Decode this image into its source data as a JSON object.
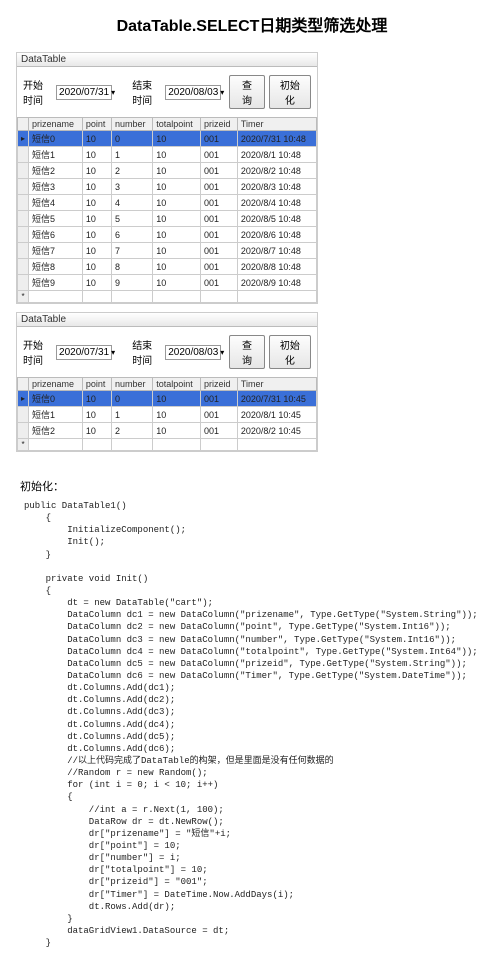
{
  "title": "DataTable.SELECT日期类型筛选处理",
  "win": {
    "caption": "DataTable",
    "startLabel": "开始时间",
    "endLabel": "结束时间",
    "startDate1": "2020/07/31",
    "endDate1": "2020/08/03",
    "startDate2": "2020/07/31",
    "endDate2": "2020/08/03",
    "queryBtn": "查询",
    "initBtn": "初始化"
  },
  "cols": [
    "prizename",
    "point",
    "number",
    "totalpoint",
    "prizeid",
    "Timer"
  ],
  "top": [
    {
      "n": "短信0",
      "p": "10",
      "u": "0",
      "t": "10",
      "id": "001",
      "time": "2020/7/31 10:48"
    },
    {
      "n": "短信1",
      "p": "10",
      "u": "1",
      "t": "10",
      "id": "001",
      "time": "2020/8/1 10:48"
    },
    {
      "n": "短信2",
      "p": "10",
      "u": "2",
      "t": "10",
      "id": "001",
      "time": "2020/8/2 10:48"
    },
    {
      "n": "短信3",
      "p": "10",
      "u": "3",
      "t": "10",
      "id": "001",
      "time": "2020/8/3 10:48"
    },
    {
      "n": "短信4",
      "p": "10",
      "u": "4",
      "t": "10",
      "id": "001",
      "time": "2020/8/4 10:48"
    },
    {
      "n": "短信5",
      "p": "10",
      "u": "5",
      "t": "10",
      "id": "001",
      "time": "2020/8/5 10:48"
    },
    {
      "n": "短信6",
      "p": "10",
      "u": "6",
      "t": "10",
      "id": "001",
      "time": "2020/8/6 10:48"
    },
    {
      "n": "短信7",
      "p": "10",
      "u": "7",
      "t": "10",
      "id": "001",
      "time": "2020/8/7 10:48"
    },
    {
      "n": "短信8",
      "p": "10",
      "u": "8",
      "t": "10",
      "id": "001",
      "time": "2020/8/8 10:48"
    },
    {
      "n": "短信9",
      "p": "10",
      "u": "9",
      "t": "10",
      "id": "001",
      "time": "2020/8/9 10:48"
    }
  ],
  "bottom": [
    {
      "n": "短信0",
      "p": "10",
      "u": "0",
      "t": "10",
      "id": "001",
      "time": "2020/7/31 10:45"
    },
    {
      "n": "短信1",
      "p": "10",
      "u": "1",
      "t": "10",
      "id": "001",
      "time": "2020/8/1 10:45"
    },
    {
      "n": "短信2",
      "p": "10",
      "u": "2",
      "t": "10",
      "id": "001",
      "time": "2020/8/2 10:45"
    }
  ],
  "initHeading": "初始化：",
  "code": "public DataTable1()\n    {\n        InitializeComponent();\n        Init();\n    }\n\n    private void Init()\n    {\n        dt = new DataTable(\"cart\");\n        DataColumn dc1 = new DataColumn(\"prizename\", Type.GetType(\"System.String\"));\n        DataColumn dc2 = new DataColumn(\"point\", Type.GetType(\"System.Int16\"));\n        DataColumn dc3 = new DataColumn(\"number\", Type.GetType(\"System.Int16\"));\n        DataColumn dc4 = new DataColumn(\"totalpoint\", Type.GetType(\"System.Int64\"));\n        DataColumn dc5 = new DataColumn(\"prizeid\", Type.GetType(\"System.String\"));\n        DataColumn dc6 = new DataColumn(\"Timer\", Type.GetType(\"System.DateTime\"));\n        dt.Columns.Add(dc1);\n        dt.Columns.Add(dc2);\n        dt.Columns.Add(dc3);\n        dt.Columns.Add(dc4);\n        dt.Columns.Add(dc5);\n        dt.Columns.Add(dc6);\n        //以上代码完成了DataTable的构架，但是里面是没有任何数据的\n        //Random r = new Random();\n        for (int i = 0; i < 10; i++)\n        {\n            //int a = r.Next(1, 100);\n            DataRow dr = dt.NewRow();\n            dr[\"prizename\"] = \"短信\"+i;\n            dr[\"point\"] = 10;\n            dr[\"number\"] = i;\n            dr[\"totalpoint\"] = 10;\n            dr[\"prizeid\"] = \"001\";\n            dr[\"Timer\"] = DateTime.Now.AddDays(i);\n            dt.Rows.Add(dr);\n        }\n        dataGridView1.DataSource = dt;\n    }"
}
